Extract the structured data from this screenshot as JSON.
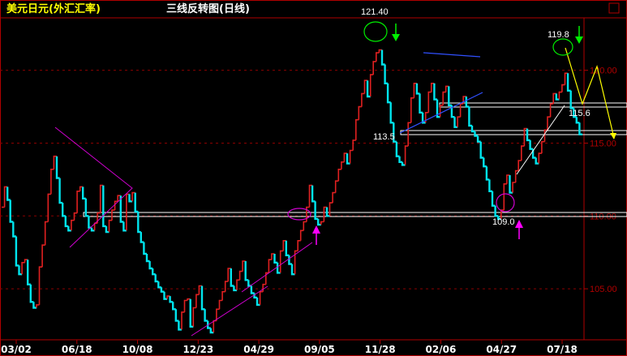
{
  "header": {
    "title": "美元日元(外汇汇率)",
    "subtitle": "三线反转图(日线)"
  },
  "chart_data": {
    "type": "line",
    "title": "三线反转图(日线)",
    "instrument": "美元日元(外汇汇率)",
    "ylim": [
      101.5,
      123.6
    ],
    "y_ticks": [
      "120.00",
      "115.00",
      "110.00",
      "105.00"
    ],
    "y_tick_values": [
      120,
      115,
      110,
      105
    ],
    "x_ticks": [
      "03/02",
      "06/18",
      "10/08",
      "12/23",
      "04/29",
      "09/05",
      "11/28",
      "02/06",
      "04/27",
      "07/18"
    ],
    "grid": true,
    "colors": {
      "up": "#e02020",
      "down": "#00e5ee",
      "grid": "#8b0000",
      "axis": "#b00000",
      "pattern": "#d000d0",
      "trend_blue": "#3050ff",
      "signal_green": "#00ee00",
      "signal_magenta": "#ff00ff",
      "forecast": "#ffff00",
      "title": "#ffff00"
    },
    "series": [
      {
        "values": [
          110.6,
          112.0,
          111.1,
          109.6,
          108.6,
          106.6,
          106.0,
          106.8,
          107.0,
          105.3,
          104.1,
          103.7,
          103.9,
          106.5,
          108.0,
          109.6,
          111.5,
          113.2,
          114.1,
          112.6,
          110.9,
          110.0,
          109.3,
          109.0,
          109.7,
          110.2,
          111.7,
          112.0,
          111.2,
          110.0,
          109.2,
          109.0,
          109.5,
          110.2,
          112.1,
          109.3,
          108.9,
          109.7,
          110.4,
          111.0,
          111.4,
          109.6,
          109.0,
          111.5,
          111.0,
          111.6,
          110.3,
          108.9,
          108.2,
          107.4,
          106.9,
          106.4,
          106.0,
          105.5,
          105.1,
          104.8,
          104.3,
          104.5,
          104.1,
          103.6,
          102.8,
          102.2,
          103.4,
          104.2,
          104.3,
          102.4,
          103.7,
          104.6,
          105.2,
          103.6,
          102.8,
          102.3,
          102.0,
          102.8,
          103.6,
          104.2,
          104.8,
          105.5,
          106.4,
          105.2,
          104.9,
          105.6,
          106.2,
          106.9,
          105.6,
          105.2,
          104.7,
          104.4,
          103.9,
          104.8,
          105.3,
          106.1,
          107.0,
          107.4,
          106.8,
          106.1,
          107.6,
          108.3,
          107.3,
          106.7,
          106.0,
          107.6,
          108.3,
          109.0,
          109.6,
          110.6,
          112.1,
          111.0,
          109.8,
          109.4,
          109.6,
          110.6,
          110.0,
          110.9,
          111.6,
          112.4,
          113.2,
          113.7,
          114.3,
          113.6,
          114.5,
          115.2,
          116.6,
          117.5,
          118.4,
          119.3,
          118.2,
          119.7,
          120.6,
          121.2,
          121.4,
          120.4,
          119.1,
          117.8,
          116.4,
          115.1,
          114.1,
          113.7,
          113.5,
          114.8,
          116.4,
          118.1,
          119.1,
          118.4,
          117.1,
          116.4,
          117.1,
          118.5,
          119.1,
          118.0,
          116.8,
          117.6,
          118.5,
          118.9,
          117.6,
          116.8,
          116.1,
          116.8,
          117.7,
          118.2,
          117.5,
          116.2,
          115.8,
          115.5,
          115.1,
          114.0,
          113.4,
          112.5,
          111.7,
          110.7,
          110.0,
          109.8,
          110.4,
          112.2,
          112.8,
          111.6,
          112.3,
          113.1,
          113.8,
          114.8,
          116.0,
          115.2,
          114.6,
          114.0,
          113.6,
          114.3,
          115.1,
          115.9,
          116.8,
          117.7,
          118.4,
          118.0,
          118.5,
          119.0,
          119.8,
          118.6,
          117.4,
          116.8,
          116.4,
          115.6
        ]
      }
    ],
    "annotations": [
      {
        "text": "121.40",
        "value": 121.4
      },
      {
        "text": "119.8",
        "value": 119.8
      },
      {
        "text": "115.6",
        "value": 115.6
      },
      {
        "text": "113.5",
        "value": 113.5
      },
      {
        "text": "109.0",
        "value": 109.0
      }
    ]
  }
}
